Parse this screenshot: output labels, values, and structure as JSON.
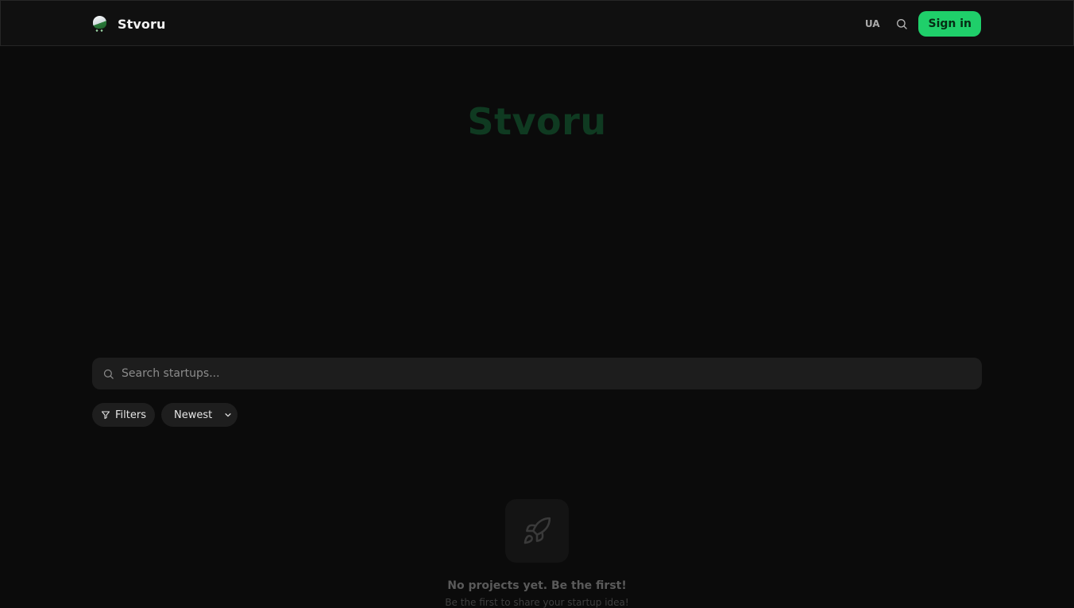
{
  "header": {
    "brand_name": "Stvoru",
    "lang_label": "UA",
    "sign_in_label": "Sign in"
  },
  "hero": {
    "title": "Stvoru"
  },
  "search": {
    "placeholder": "Search startups..."
  },
  "toolbar": {
    "filters_label": "Filters",
    "sort_selected": "Newest"
  },
  "empty_state": {
    "title": "No projects yet. Be the first!",
    "subtitle": "Be the first to share your startup idea!"
  },
  "colors": {
    "accent": "#1fcf6a",
    "background": "#0b0b0b",
    "hero_title": "#0f3a21"
  },
  "icons": {
    "search": "search-icon",
    "filter": "filter-icon",
    "dropdown": "chevron-down-icon",
    "empty": "rocket-icon",
    "logo": "logo-icon"
  }
}
